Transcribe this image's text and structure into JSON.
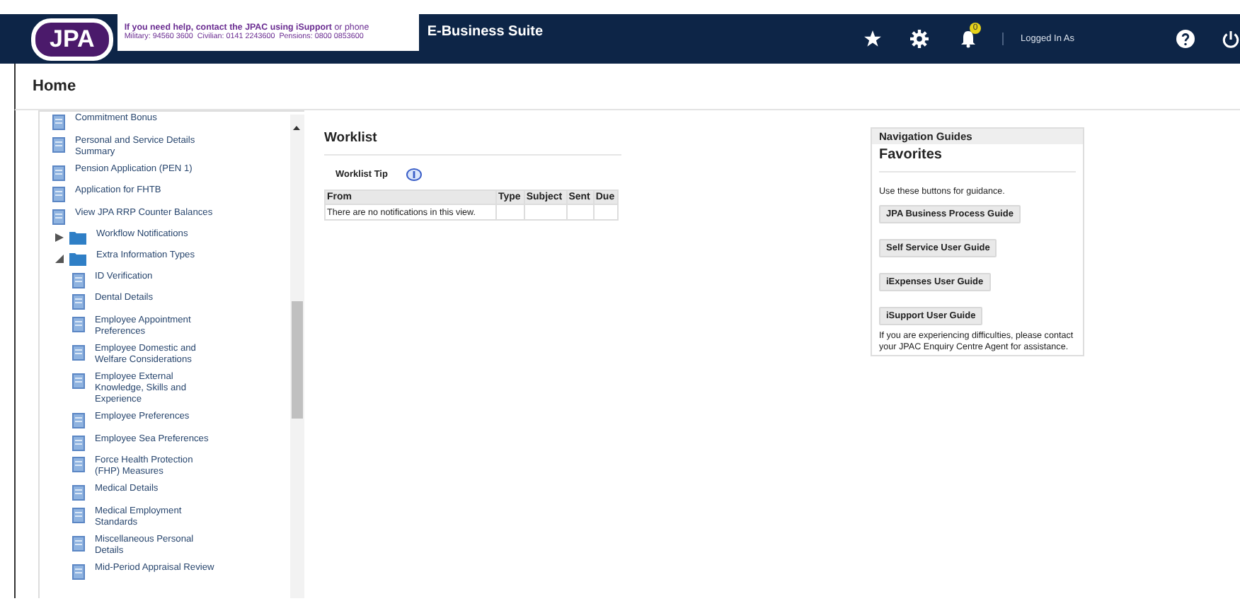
{
  "header": {
    "logo": "JPA",
    "help_line_1": "**If you need help, contact the JPAC using iSupport** or phone",
    "help_line_2": "Military: 94560 3600  Civilian: 0141 2243600  Pensions: 0800 0853600",
    "title": "E-Business Suite",
    "notification_count": "0",
    "user_label": "Logged In As"
  },
  "page_title": "Home",
  "sidebar": {
    "items": [
      {
        "kind": "doc",
        "label": "Commitment Bonus"
      },
      {
        "kind": "doc",
        "label": "Personal and Service Details Summary"
      },
      {
        "kind": "doc",
        "label": "Pension Application (PEN 1)"
      },
      {
        "kind": "doc",
        "label": "Application for FHTB"
      },
      {
        "kind": "doc",
        "label": "View JPA RRP Counter Balances"
      },
      {
        "kind": "folder",
        "label": "Workflow Notifications",
        "expanded": false
      },
      {
        "kind": "folder",
        "label": "Extra Information Types",
        "expanded": true,
        "children": [
          {
            "kind": "doc",
            "label": "ID Verification"
          },
          {
            "kind": "doc",
            "label": "Dental Details"
          },
          {
            "kind": "doc",
            "label": "Employee Appointment Preferences"
          },
          {
            "kind": "doc",
            "label": "Employee Domestic and Welfare Considerations"
          },
          {
            "kind": "doc",
            "label": "Employee External Knowledge, Skills and Experience"
          },
          {
            "kind": "doc",
            "label": "Employee Preferences"
          },
          {
            "kind": "doc",
            "label": "Employee Sea Preferences"
          },
          {
            "kind": "doc",
            "label": "Force Health Protection (FHP) Measures"
          },
          {
            "kind": "doc",
            "label": "Medical Details"
          },
          {
            "kind": "doc",
            "label": "Medical Employment Standards"
          },
          {
            "kind": "doc",
            "label": "Miscellaneous Personal Details"
          },
          {
            "kind": "doc",
            "label": "Mid-Period Appraisal Review"
          }
        ]
      }
    ]
  },
  "worklist": {
    "title": "Worklist",
    "tip": "Worklist Tip",
    "columns": [
      "From",
      "Type",
      "Subject",
      "Sent",
      "Due"
    ],
    "empty_message": "There are no notifications in this view."
  },
  "navigation_guides": {
    "title": "Navigation Guides",
    "subtitle": "Favorites",
    "intro": "Use these buttons for guidance.",
    "buttons": [
      "JPA Business Process Guide",
      "Self Service User Guide",
      "iExpenses User Guide",
      "iSupport User Guide"
    ],
    "footer": "If you are experiencing difficulties, please contact your JPAC Enquiry Centre Agent for assistance."
  }
}
